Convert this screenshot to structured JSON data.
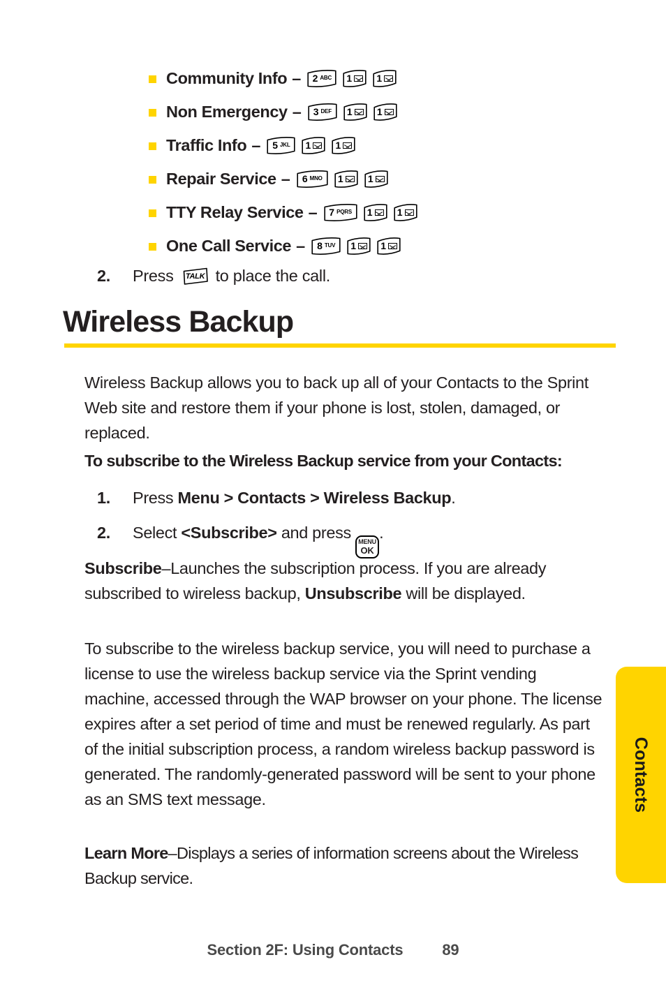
{
  "document": {
    "section_heading": "Wireless Backup",
    "accent_color": "#FFD400",
    "text_color": "#231f20"
  },
  "bullet_list": {
    "items": [
      {
        "label": "Community Info",
        "dash": "–",
        "keys": [
          {
            "type": "digit-letters",
            "digit": "2",
            "letters": "ABC",
            "icon": "key-2-abc-icon"
          },
          {
            "type": "digit-envelope",
            "digit": "1",
            "icon": "key-1-message-icon"
          },
          {
            "type": "digit-envelope",
            "digit": "1",
            "icon": "key-1-message-icon"
          }
        ]
      },
      {
        "label": "Non Emergency",
        "dash": "–",
        "keys": [
          {
            "type": "digit-letters",
            "digit": "3",
            "letters": "DEF",
            "icon": "key-3-def-icon"
          },
          {
            "type": "digit-envelope",
            "digit": "1",
            "icon": "key-1-message-icon"
          },
          {
            "type": "digit-envelope",
            "digit": "1",
            "icon": "key-1-message-icon"
          }
        ]
      },
      {
        "label": "Traffic Info",
        "dash": "–",
        "keys": [
          {
            "type": "digit-letters",
            "digit": "5",
            "letters": "JKL",
            "icon": "key-5-jkl-icon"
          },
          {
            "type": "digit-envelope",
            "digit": "1",
            "icon": "key-1-message-icon"
          },
          {
            "type": "digit-envelope",
            "digit": "1",
            "icon": "key-1-message-icon"
          }
        ]
      },
      {
        "label": "Repair Service",
        "dash": "–",
        "keys": [
          {
            "type": "digit-letters",
            "digit": "6",
            "letters": "MNO",
            "icon": "key-6-mno-icon"
          },
          {
            "type": "digit-envelope",
            "digit": "1",
            "icon": "key-1-message-icon"
          },
          {
            "type": "digit-envelope",
            "digit": "1",
            "icon": "key-1-message-icon"
          }
        ]
      },
      {
        "label": "TTY Relay Service",
        "dash": "–",
        "keys": [
          {
            "type": "digit-letters",
            "digit": "7",
            "letters": "PQRS",
            "icon": "key-7-pqrs-icon"
          },
          {
            "type": "digit-envelope",
            "digit": "1",
            "icon": "key-1-message-icon"
          },
          {
            "type": "digit-envelope",
            "digit": "1",
            "icon": "key-1-message-icon"
          }
        ]
      },
      {
        "label": "One Call Service",
        "dash": "–",
        "keys": [
          {
            "type": "digit-letters",
            "digit": "8",
            "letters": "TUV",
            "icon": "key-8-tuv-icon"
          },
          {
            "type": "digit-envelope",
            "digit": "1",
            "icon": "key-1-message-icon"
          },
          {
            "type": "digit-envelope",
            "digit": "1",
            "icon": "key-1-message-icon"
          }
        ]
      }
    ]
  },
  "talk_step": {
    "number": "2.",
    "before": "Press",
    "key_label": "TALK",
    "key_icon": "key-talk-icon",
    "after": "to place the call."
  },
  "intro_paragraph": "Wireless Backup allows you to back up all of your Contacts to the Sprint Web site and restore them if your phone is lost, stolen, damaged, or replaced.",
  "subscribe_lead": "To subscribe to the Wireless Backup service from your Contacts:",
  "steps": [
    {
      "number": "1.",
      "prefix": "Press ",
      "bold": "Menu > Contacts > Wireless Backup",
      "suffix": "."
    },
    {
      "number": "2.",
      "prefix": "Select ",
      "bold": "<Subscribe>",
      "middle": " and press ",
      "key_line1": "MENU",
      "key_line2": "OK",
      "key_icon": "key-menu-ok-icon",
      "suffix": "."
    }
  ],
  "subscribe_paragraph": {
    "term": "Subscribe",
    "body_1": "–Launches the subscription process. If you are already subscribed to wireless backup, ",
    "term_2": "Unsubscribe",
    "body_2": " will be displayed."
  },
  "license_paragraph": "To subscribe to the wireless backup service, you will need to purchase a license to use the wireless backup service via the Sprint vending machine, accessed through the WAP browser on your phone. The license expires after a set period of time and must be renewed regularly. As part of the initial subscription process, a random wireless backup password is generated. The randomly-generated password will be sent to your phone as an SMS text message.",
  "learn_more_paragraph": {
    "term": "Learn More",
    "body": "–Displays a series of information screens about the Wireless Backup service."
  },
  "side_tab": {
    "label": "Contacts"
  },
  "footer": {
    "section": "Section 2F: Using Contacts",
    "page": "89"
  }
}
